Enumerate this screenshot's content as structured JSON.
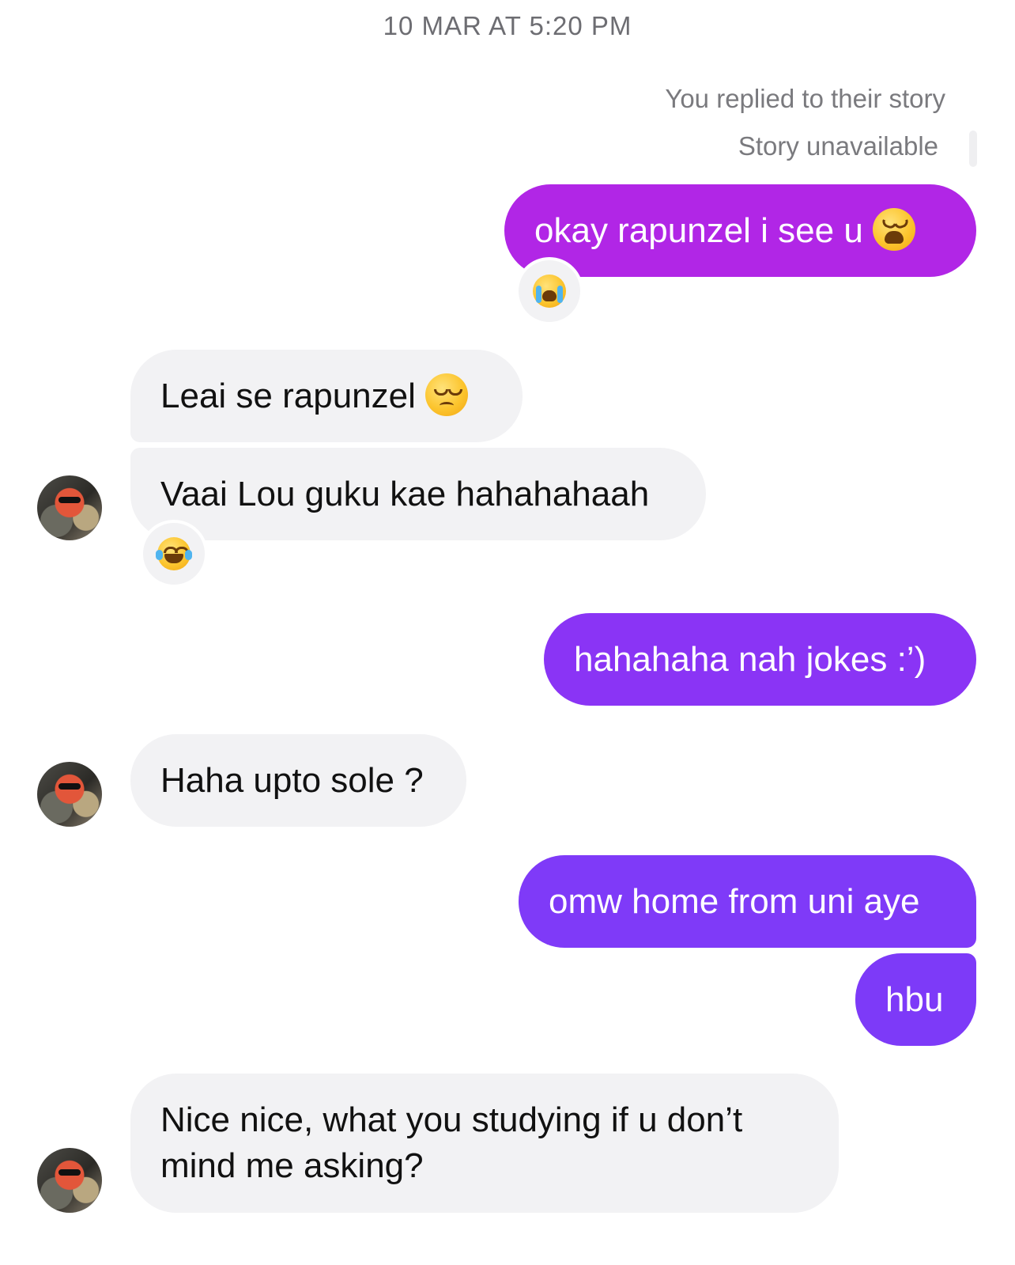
{
  "conversation": {
    "timestamp": "10 MAR AT 5:20 PM",
    "story_reply": {
      "label": "You replied to their story",
      "status": "Story unavailable"
    },
    "colors": {
      "sent_bubble_top": "#b026e6",
      "sent_bubble_mid": "#8a34f5",
      "sent_bubble_bottom": "#7d3af8",
      "received_bubble": "#f2f2f4"
    },
    "messages": [
      {
        "from": "me",
        "text": "okay rapunzel i see u",
        "emoji": "weary-face",
        "reaction": "loudly-crying-face"
      },
      {
        "from": "them",
        "text": "Leai se rapunzel",
        "emoji": "pensive-face"
      },
      {
        "from": "them",
        "text": "Vaai Lou guku kae hahahahaah",
        "reaction": "tears-of-joy-face"
      },
      {
        "from": "me",
        "text": "hahahaha nah jokes :’)"
      },
      {
        "from": "them",
        "text": "Haha upto sole ?"
      },
      {
        "from": "me",
        "text": "omw home from uni aye"
      },
      {
        "from": "me",
        "text": "hbu"
      },
      {
        "from": "them",
        "text_line1": "Nice nice, what you studying if u don’t",
        "text_line2": "mind me asking?"
      }
    ]
  }
}
